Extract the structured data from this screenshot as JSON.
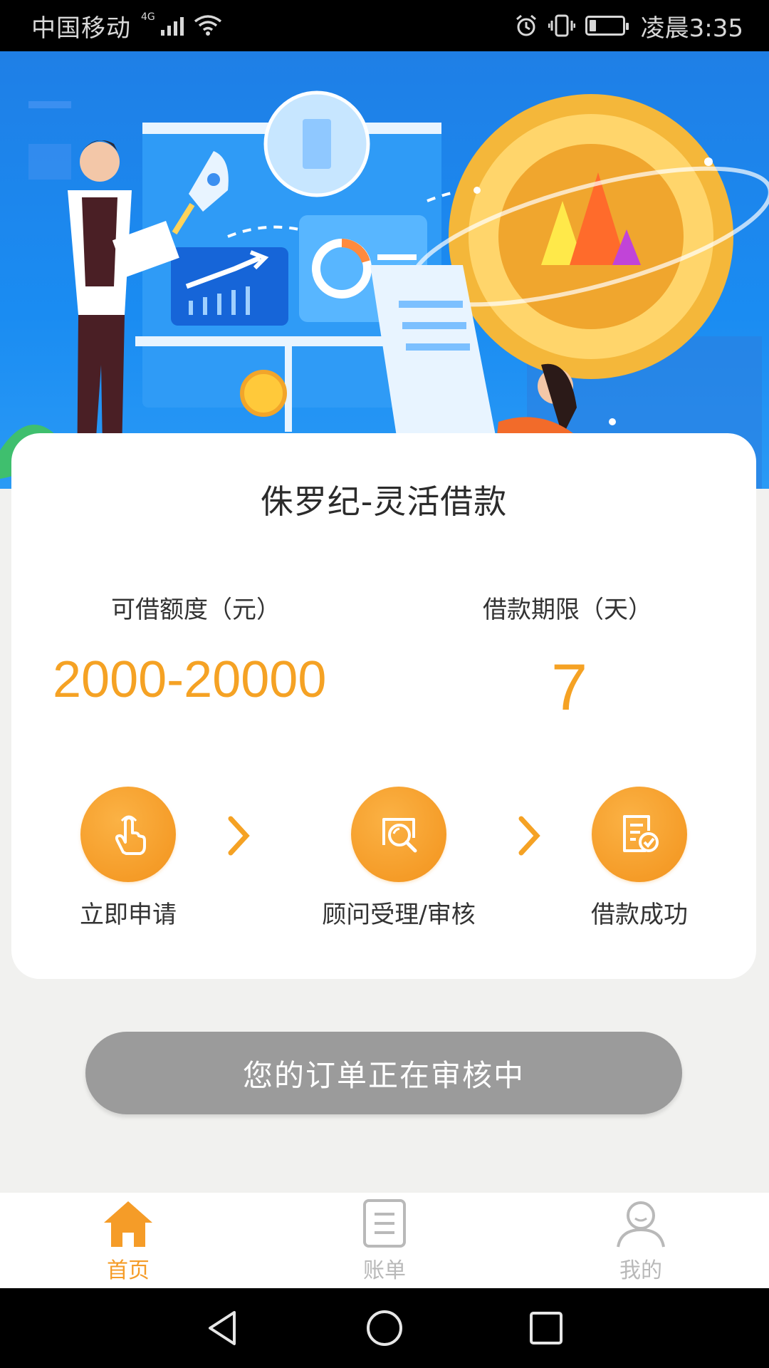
{
  "status_bar": {
    "carrier": "中国移动",
    "network": "4G",
    "time": "凌晨3:35"
  },
  "hero": {
    "icons": [
      "rocket-icon",
      "coin-icon",
      "chart-icon",
      "document-icon"
    ]
  },
  "card": {
    "title": "侏罗纪-灵活借款",
    "amount_label": "可借额度（元）",
    "amount_value": "2000-20000",
    "term_label": "借款期限（天）",
    "term_value": "7",
    "steps": [
      {
        "label": "立即申请",
        "icon": "hand-tap-icon"
      },
      {
        "label": "顾问受理/审核",
        "icon": "magnifier-icon"
      },
      {
        "label": "借款成功",
        "icon": "document-check-icon"
      }
    ]
  },
  "review_button": {
    "label": "您的订单正在审核中"
  },
  "tab_bar": {
    "tabs": [
      {
        "label": "首页",
        "icon": "home-icon",
        "active": true
      },
      {
        "label": "账单",
        "icon": "bill-icon",
        "active": false
      },
      {
        "label": "我的",
        "icon": "user-icon",
        "active": false
      }
    ]
  },
  "colors": {
    "accent": "#f59c28",
    "hero_blue": "#1a8cf2",
    "button_gray": "#9b9b9b"
  }
}
